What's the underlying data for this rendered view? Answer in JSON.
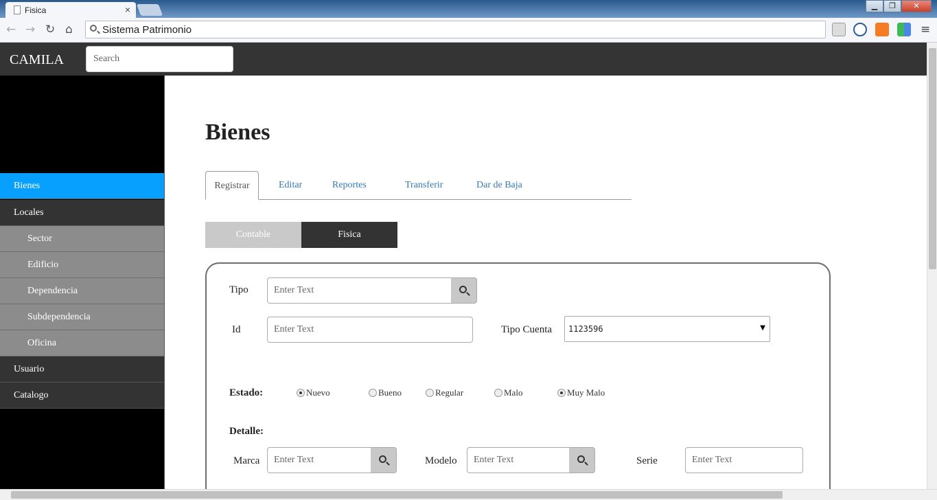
{
  "browser": {
    "tab_title": "Fisica",
    "tab_close": "×",
    "address": "Sistema Patrimonio",
    "back": "←",
    "forward": "→",
    "reload": "↻",
    "home": "⌂",
    "menu": "≡",
    "win_minimize": "▁",
    "win_maximize": "❐",
    "win_close": "✕"
  },
  "navbar": {
    "brand": "CAMILA",
    "search_placeholder": "Search"
  },
  "sidebar": {
    "items": [
      {
        "label": "Bienes"
      },
      {
        "label": "Locales"
      },
      {
        "label": "Sector"
      },
      {
        "label": "Edificio"
      },
      {
        "label": "Dependencia"
      },
      {
        "label": "Subdependencia"
      },
      {
        "label": "Oficina"
      },
      {
        "label": "Usuario"
      },
      {
        "label": "Catalogo"
      }
    ]
  },
  "main": {
    "title": "Bienes",
    "tabs": [
      {
        "label": "Registrar"
      },
      {
        "label": "Editar"
      },
      {
        "label": "Reportes"
      },
      {
        "label": "Transferir"
      },
      {
        "label": "Dar de Baja"
      }
    ],
    "toggle": {
      "contable": "Contable",
      "fisica": "Fisica",
      "selected": "Fisica"
    }
  },
  "form": {
    "tipo_label": "Tipo",
    "tipo_placeholder": "Enter Text",
    "id_label": "Id",
    "id_placeholder": "Enter Text",
    "tipo_cuenta_label": "Tipo Cuenta",
    "tipo_cuenta_value": "1123596",
    "estado_label": "Estado:",
    "estado_options": [
      {
        "label": "Nuevo",
        "checked": true
      },
      {
        "label": "Bueno",
        "checked": false
      },
      {
        "label": "Regular",
        "checked": false
      },
      {
        "label": "Malo",
        "checked": false
      },
      {
        "label": "Muy Malo",
        "checked": true
      }
    ],
    "detalle_label": "Detalle:",
    "marca_label": "Marca",
    "marca_placeholder": "Enter Text",
    "modelo_label": "Modelo",
    "modelo_placeholder": "Enter Text",
    "serie_label": "Serie",
    "serie_placeholder": "Enter Text"
  },
  "colors": {
    "navbar_bg": "#343434",
    "sidebar_active": "#08a0ff",
    "link": "#337ab7"
  }
}
